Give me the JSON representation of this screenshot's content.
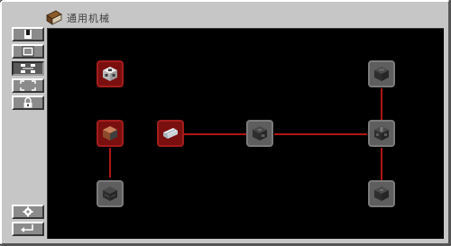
{
  "window": {
    "title": "通用机械"
  },
  "icons": {
    "title": "book-icon",
    "sidebar": [
      "bookmark-icon",
      "page-list-icon",
      "tree-view-icon",
      "frame-view-icon",
      "lock-icon",
      "gear-icon",
      "return-arrow-icon"
    ]
  },
  "colors": {
    "panel": "#c6c6c6",
    "canvas": "#000000",
    "connector": "#b01515",
    "node_unlocked": "#7a0f0f",
    "node_locked": "#5e5e5e"
  },
  "nodes": [
    {
      "name": "machine-block-node",
      "state": "unlocked"
    },
    {
      "name": "copper-block-node",
      "state": "unlocked"
    },
    {
      "name": "pipe-item-node",
      "state": "unlocked"
    },
    {
      "name": "iron-block-node",
      "state": "locked"
    },
    {
      "name": "mid-block-node",
      "state": "locked"
    },
    {
      "name": "top-right-block-node",
      "state": "locked"
    },
    {
      "name": "hub-block-node",
      "state": "locked"
    },
    {
      "name": "bottom-right-block-node",
      "state": "locked"
    }
  ]
}
